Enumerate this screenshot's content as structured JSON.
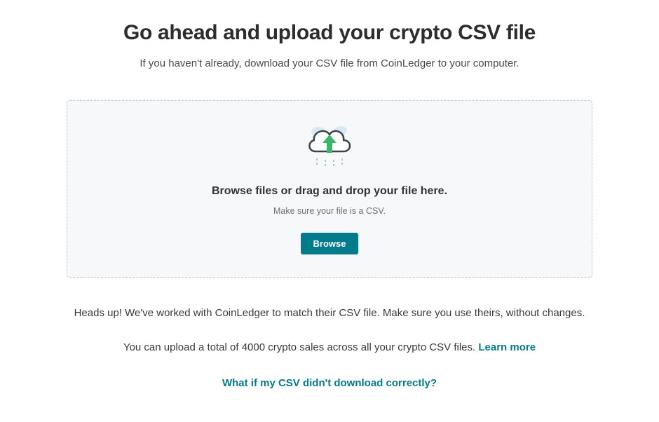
{
  "header": {
    "title": "Go ahead and upload your crypto CSV file",
    "subtitle": "If you haven't already, download your CSV file from CoinLedger to your computer."
  },
  "dropzone": {
    "instruction": "Browse files or drag and drop your file here.",
    "hint": "Make sure your file is a CSV.",
    "browse_label": "Browse"
  },
  "notes": {
    "heads_up": "Heads up! We've worked with CoinLedger to match their CSV file. Make sure you use theirs, without changes.",
    "upload_limit_prefix": "You can upload a total of 4000 crypto sales across all your crypto CSV files. ",
    "learn_more_label": "Learn more",
    "help_link": "What if my CSV didn't download correctly?"
  },
  "icons": {
    "cloud_upload": "cloud-upload-icon"
  }
}
